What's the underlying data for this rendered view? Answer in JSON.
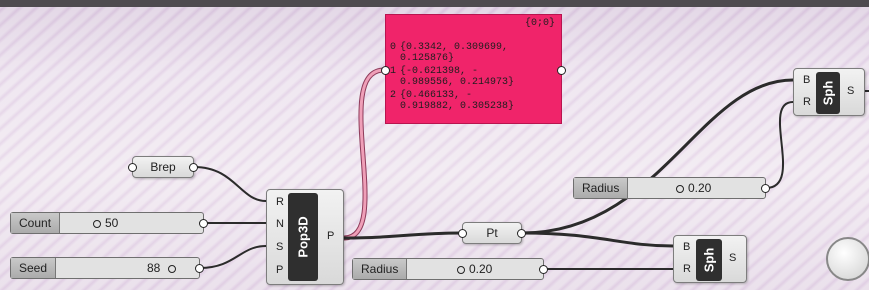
{
  "components": {
    "brep": {
      "label": "Brep"
    },
    "count": {
      "label": "Count",
      "value": "50"
    },
    "seed": {
      "label": "Seed",
      "value": "88"
    },
    "pop3d": {
      "label": "Pop3D",
      "inputs": [
        "R",
        "N",
        "S",
        "P"
      ],
      "output": "P"
    },
    "pt": {
      "label": "Pt"
    },
    "radius_bottom": {
      "label": "Radius",
      "value": "0.20"
    },
    "radius_top": {
      "label": "Radius",
      "value": "0.20"
    },
    "sphere_top": {
      "label": "Sph",
      "inputs": [
        "B",
        "R"
      ],
      "output": "S"
    },
    "sphere_bottom": {
      "label": "Sph",
      "inputs": [
        "B",
        "R"
      ],
      "output": "S"
    }
  },
  "panel": {
    "header": "{0;0}",
    "rows": [
      {
        "index": "0",
        "lines": [
          "{0.3342, 0.309699,",
          "0.125876}"
        ]
      },
      {
        "index": "1",
        "lines": [
          "{-0.621398, -",
          "0.989556, 0.214973}"
        ]
      },
      {
        "index": "2",
        "lines": [
          "{0.466133, -",
          "0.919882, 0.305238}"
        ]
      }
    ]
  },
  "colors": {
    "panel": "#f0246a",
    "wire": "#2b2b2b",
    "wire_selected": "#ef9fb8",
    "background": "#ece3ee"
  },
  "icons": [
    "navigation-ball-icon"
  ]
}
